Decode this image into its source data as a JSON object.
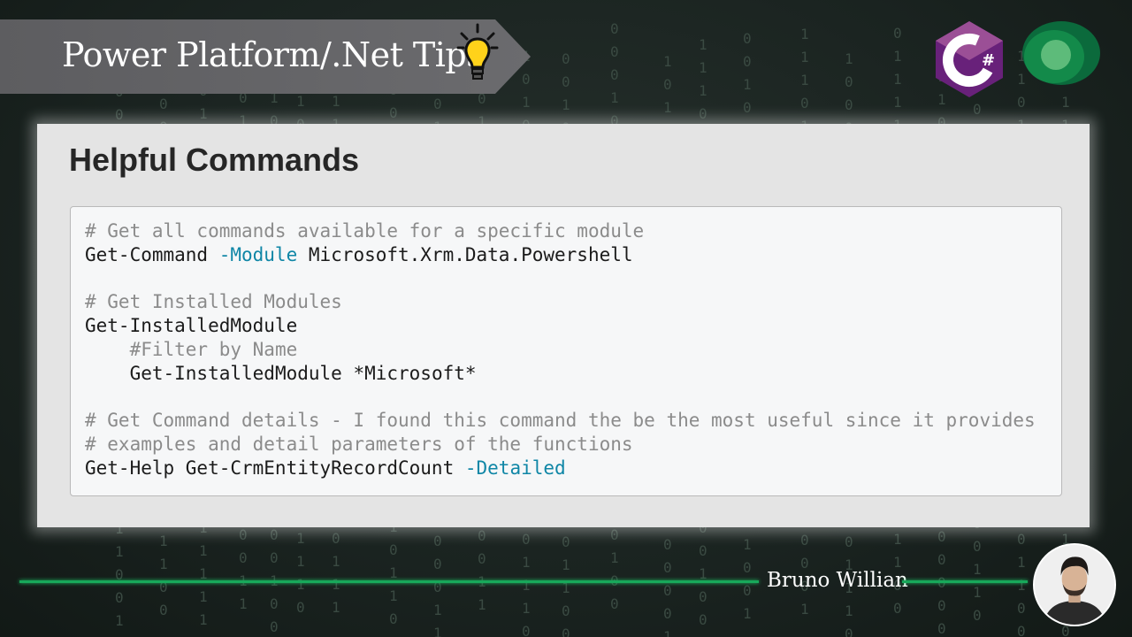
{
  "header": {
    "title": "Power Platform/.Net Tips",
    "bulb_icon": "lightbulb-icon"
  },
  "logos": {
    "csharp": "csharp-logo-icon",
    "dataverse": "dataverse-logo-icon"
  },
  "section_title": "Helpful Commands",
  "code": {
    "lines": [
      {
        "indent": "",
        "parts": [
          {
            "t": "# Get all commands available for a specific module",
            "c": "cmt"
          }
        ]
      },
      {
        "indent": "",
        "parts": [
          {
            "t": "Get-Command ",
            "c": ""
          },
          {
            "t": "-Module",
            "c": "kw"
          },
          {
            "t": " Microsoft.Xrm.Data.Powershell",
            "c": ""
          }
        ]
      },
      {
        "indent": "",
        "parts": []
      },
      {
        "indent": "",
        "parts": [
          {
            "t": "# Get Installed Modules",
            "c": "cmt"
          }
        ]
      },
      {
        "indent": "",
        "parts": [
          {
            "t": "Get-InstalledModule",
            "c": ""
          }
        ]
      },
      {
        "indent": "    ",
        "parts": [
          {
            "t": "#Filter by Name",
            "c": "cmt"
          }
        ]
      },
      {
        "indent": "    ",
        "parts": [
          {
            "t": "Get-InstalledModule *Microsoft*",
            "c": ""
          }
        ]
      },
      {
        "indent": "",
        "parts": []
      },
      {
        "indent": "",
        "parts": [
          {
            "t": "# Get Command details - I found this command the be the most useful since it provides",
            "c": "cmt"
          }
        ]
      },
      {
        "indent": "",
        "parts": [
          {
            "t": "# examples and detail parameters of the functions",
            "c": "cmt"
          }
        ]
      },
      {
        "indent": "",
        "parts": [
          {
            "t": "Get-Help Get-CrmEntityRecordCount ",
            "c": ""
          },
          {
            "t": "-Detailed",
            "c": "kw"
          }
        ]
      }
    ]
  },
  "footer": {
    "author": "Bruno Willian",
    "avatar_icon": "author-avatar"
  },
  "colors": {
    "accent_green": "#18a85a",
    "keyword_blue": "#0f86a6",
    "comment_gray": "#8b8b8b"
  }
}
